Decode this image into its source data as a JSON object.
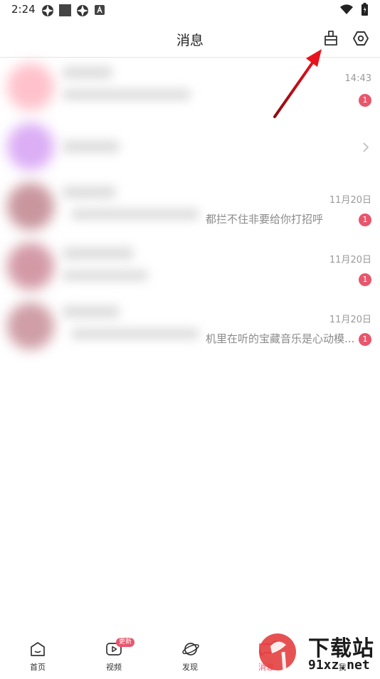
{
  "status_bar": {
    "time": "2:24"
  },
  "header": {
    "title": "消息"
  },
  "messages": [
    {
      "time": "14:43",
      "preview": "",
      "badge": "1",
      "avatar_color": "#ffc2cc"
    },
    {
      "time": "",
      "preview": "",
      "badge": "",
      "avatar_color": "#dcaef5"
    },
    {
      "time": "11月20日",
      "preview": "都拦不住非要给你打招呼",
      "badge": "1",
      "avatar_color": "#c9969e"
    },
    {
      "time": "11月20日",
      "preview": "",
      "badge": "1",
      "avatar_color": "#d39aa6"
    },
    {
      "time": "11月20日",
      "preview": "机里在听的宝藏音乐是心动模...",
      "badge": "1",
      "avatar_color": "#cf9ea6"
    }
  ],
  "bottom_nav": {
    "items": [
      {
        "label": "首页"
      },
      {
        "label": "视频",
        "badge": "更新"
      },
      {
        "label": "发现"
      },
      {
        "label": "消息",
        "dot": "4"
      },
      {
        "label": "我"
      }
    ]
  },
  "watermark": {
    "main": "下载站",
    "sub": "91xz.net"
  },
  "colors": {
    "accent": "#e8566c",
    "annotation": "#d8101c"
  }
}
